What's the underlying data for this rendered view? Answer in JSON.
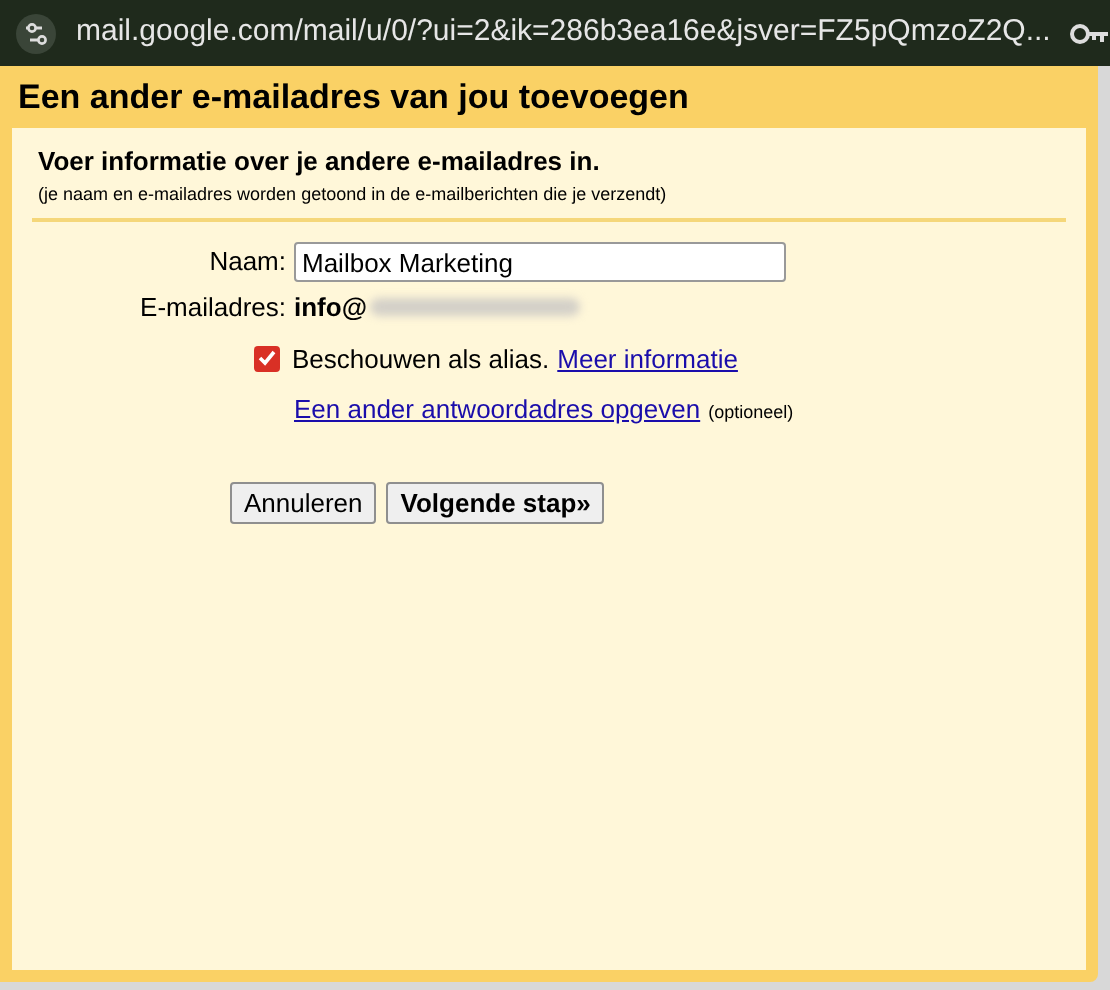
{
  "address_bar": {
    "url": "mail.google.com/mail/u/0/?ui=2&ik=286b3ea16e&jsver=FZ5pQmzoZ2Q..."
  },
  "dialog": {
    "title": "Een ander e-mailadres van jou toevoegen",
    "heading": "Voer informatie over je andere e-mailadres in.",
    "subheading": "(je naam en e-mailadres worden getoond in de e-mailberichten die je verzendt)",
    "name_label": "Naam:",
    "name_value": "Mailbox Marketing",
    "email_label": "E-mailadres:",
    "email_value": "info@",
    "email_redacted": true,
    "alias": {
      "label": "Beschouwen als alias.",
      "checked": true,
      "link": "Meer informatie"
    },
    "reply_link": "Een ander antwoordadres opgeven",
    "reply_note": "(optioneel)",
    "buttons": [
      {
        "label": "Annuleren",
        "primary": false
      },
      {
        "label": "Volgende stap»",
        "primary": true
      }
    ]
  }
}
